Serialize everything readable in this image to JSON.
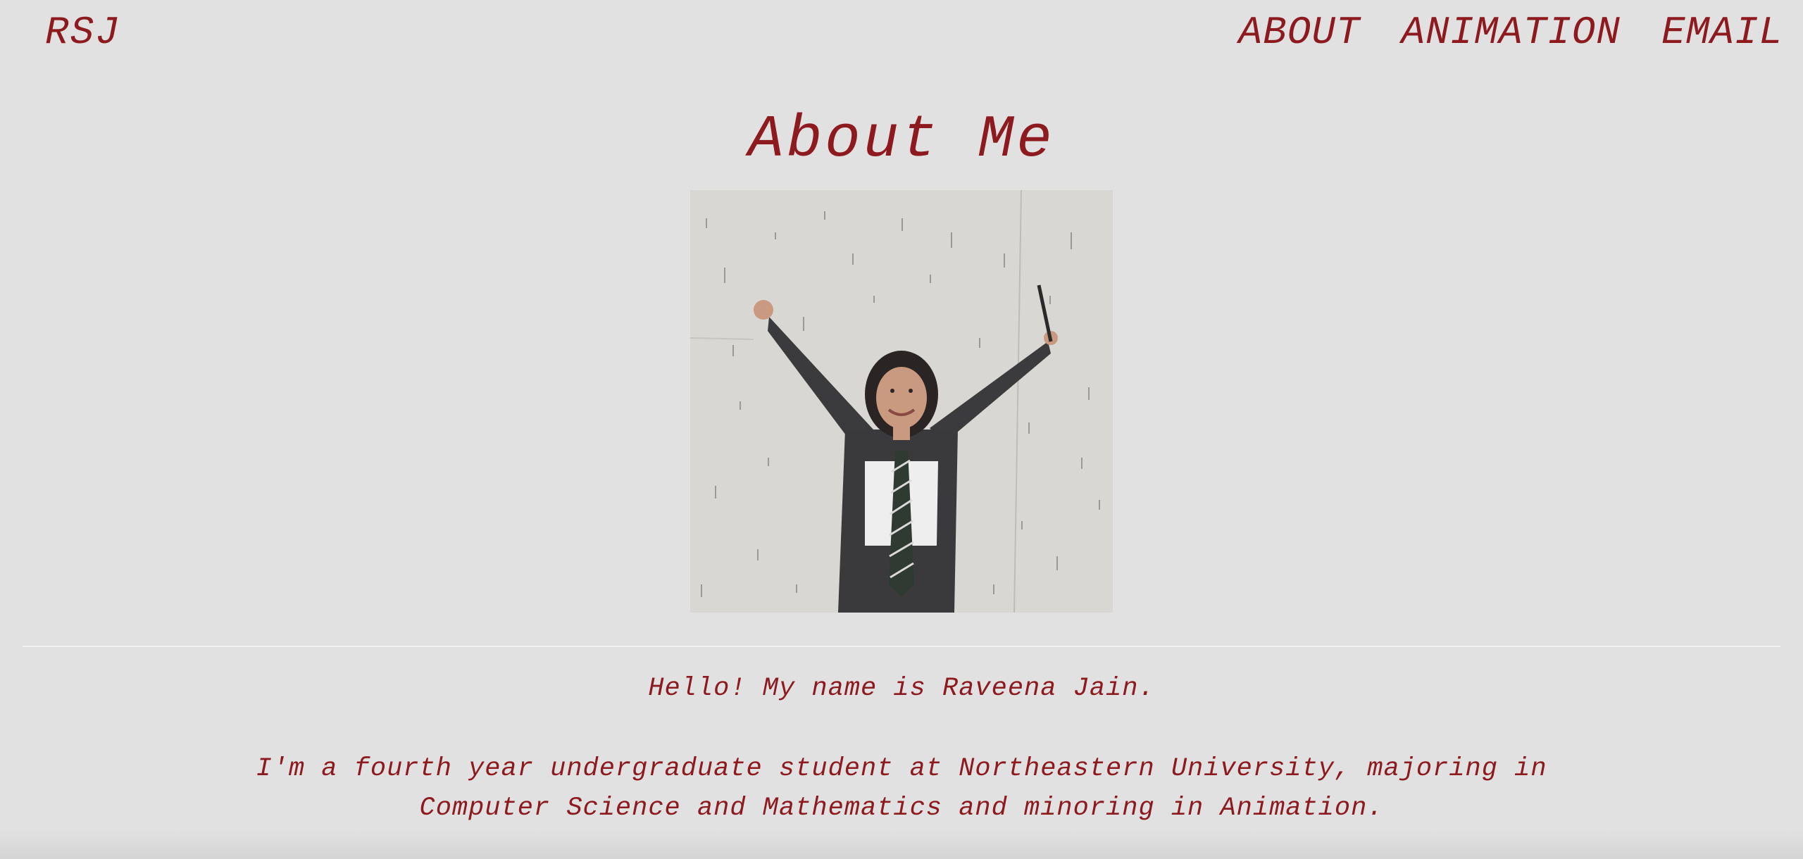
{
  "header": {
    "brand": "RSJ",
    "nav": [
      {
        "label": "ABOUT"
      },
      {
        "label": "ANIMATION"
      },
      {
        "label": "EMAIL"
      }
    ]
  },
  "main": {
    "title": "About Me",
    "photo": {
      "alt": "Portrait of Raveena Jain with arms raised against a concrete wall"
    },
    "intro": "Hello! My name is Raveena Jain.",
    "bio": "I'm a fourth year undergraduate student at Northeastern University, majoring in Computer Science and Mathematics and minoring in Animation."
  },
  "colors": {
    "background": "#e1e1e1",
    "accent": "#8d1a1f",
    "divider": "#f0f0f0"
  }
}
